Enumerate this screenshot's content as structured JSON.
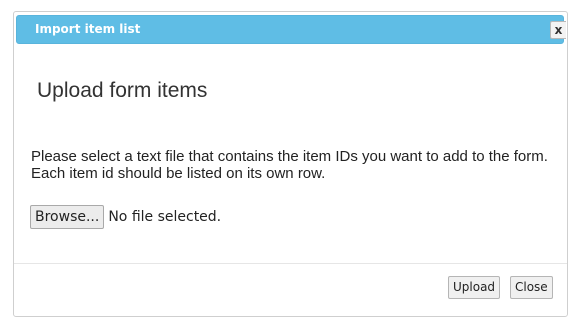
{
  "dialog": {
    "title": "Import item list",
    "close_glyph": "x"
  },
  "content": {
    "heading": "Upload form items",
    "description": "Please select a text file that contains the item IDs you want to add to the form. Each item id should be listed on its own row.",
    "file_input": {
      "browse_label": "Browse...",
      "status": "No file selected."
    }
  },
  "footer": {
    "upload_label": "Upload",
    "close_label": "Close"
  },
  "colors": {
    "titlebar": "#5fbde5",
    "title_text": "#ffffff"
  }
}
